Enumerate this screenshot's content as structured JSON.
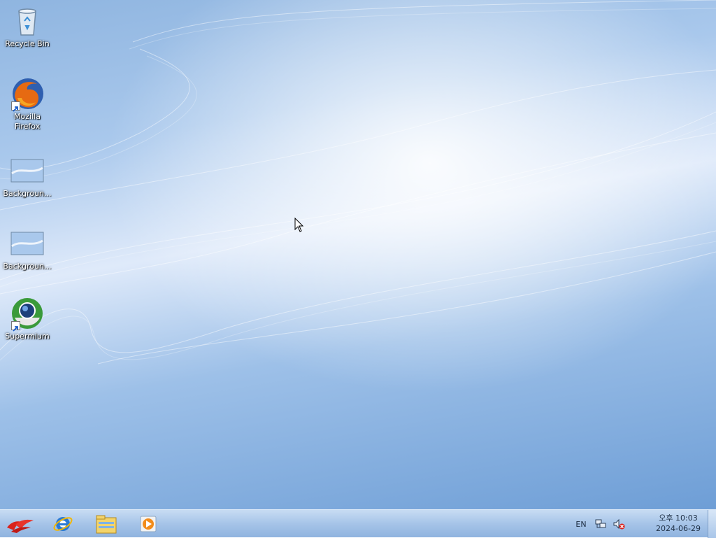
{
  "desktop": {
    "icons": [
      {
        "label": "Recycle Bin",
        "icon": "recycle-bin-icon"
      },
      {
        "label": "Mozilla Firefox",
        "icon": "firefox-icon"
      },
      {
        "label": "Backgroun...",
        "icon": "image-file-icon"
      },
      {
        "label": "Backgroun...",
        "icon": "image-file-icon"
      },
      {
        "label": "Supermium",
        "icon": "supermium-icon"
      }
    ]
  },
  "taskbar": {
    "start": {
      "icon": "start-logo-icon"
    },
    "pinned": [
      {
        "icon": "internet-explorer-icon"
      },
      {
        "icon": "file-explorer-icon"
      },
      {
        "icon": "media-player-icon"
      }
    ],
    "tray": {
      "language": "EN",
      "network_icon": "network-icon",
      "volume_icon": "volume-muted-icon",
      "clock_time": "오후 10:03",
      "clock_date": "2024-06-29"
    }
  },
  "colors": {
    "taskbar": "#a6c4e8",
    "wallpaper_light": "#dfeafa",
    "wallpaper_dark": "#6e9ed6"
  }
}
